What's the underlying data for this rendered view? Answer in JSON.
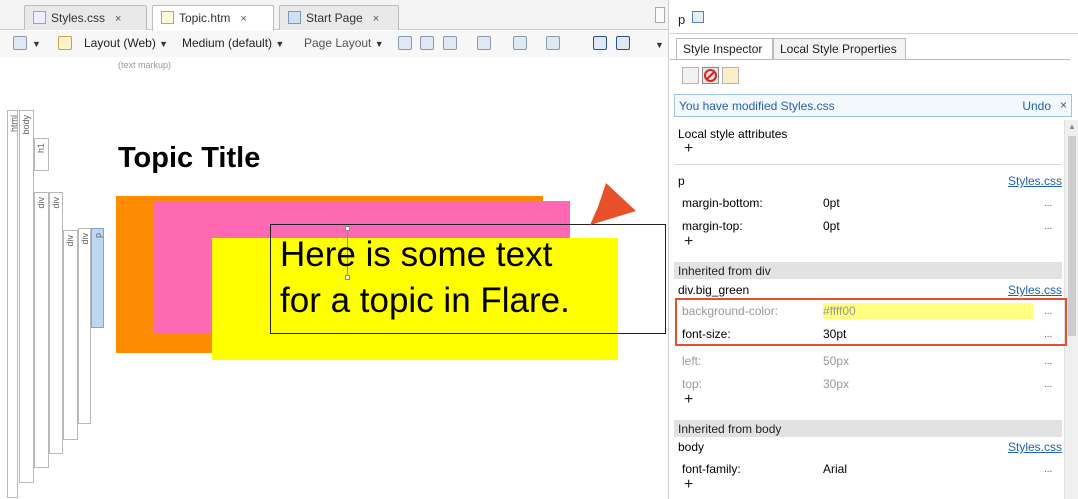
{
  "tabs": [
    {
      "label": "Styles.css",
      "close": "×"
    },
    {
      "label": "Topic.htm",
      "close": "×"
    },
    {
      "label": "Start Page",
      "close": "×"
    }
  ],
  "toolbar": {
    "layout": "Layout (Web)",
    "medium": "Medium (default)",
    "page_layout": "Page Layout",
    "markup_hint": "(text markup)"
  },
  "structure_bars": [
    "html",
    "body",
    "h1",
    "div",
    "div",
    "div",
    "div",
    "p"
  ],
  "editor": {
    "title": "Topic Title",
    "body_line1": "Here is some text",
    "body_line2": "for a topic in Flare."
  },
  "panel": {
    "tag": "p",
    "tabs": [
      "Style Inspector",
      "Local Style Properties"
    ],
    "banner": {
      "text": "You have modified Styles.css",
      "undo": "Undo",
      "close": "×"
    },
    "local_header": "Local style attributes",
    "plus": "+",
    "rule_p": {
      "selector": "p",
      "source": "Styles.css",
      "props": [
        {
          "name": "margin-bottom:",
          "value": "0pt",
          "dots": "..."
        },
        {
          "name": "margin-top:",
          "value": "0pt",
          "dots": "..."
        }
      ]
    },
    "inherited_div": {
      "header": "Inherited from div",
      "selector": "div.big_green",
      "source": "Styles.css",
      "props": [
        {
          "name": "background-color:",
          "value": "#ffff00",
          "dots": "..."
        },
        {
          "name": "font-size:",
          "value": "30pt",
          "dots": "..."
        },
        {
          "name": "left:",
          "value": "50px",
          "dots": "..."
        },
        {
          "name": "top:",
          "value": "30px",
          "dots": "..."
        }
      ]
    },
    "inherited_body": {
      "header": "Inherited from body",
      "selector": "body",
      "source": "Styles.css",
      "props": [
        {
          "name": "font-family:",
          "value": "Arial",
          "dots": "..."
        }
      ]
    }
  },
  "colors": {
    "orange": "#ff8c00",
    "pink": "#ff69b4",
    "yellow": "#ffff00",
    "link": "#1f62b8",
    "highlight": "#e0542b",
    "arrow": "#e8502a"
  },
  "icons": [
    "tab-css-icon",
    "tab-htm-icon",
    "start-page-icon",
    "search-icon",
    "layout-icon",
    "up-arrow-icon",
    "new-style-icon",
    "no-style-icon",
    "edit-style-icon",
    "flare-arrow-icon"
  ]
}
